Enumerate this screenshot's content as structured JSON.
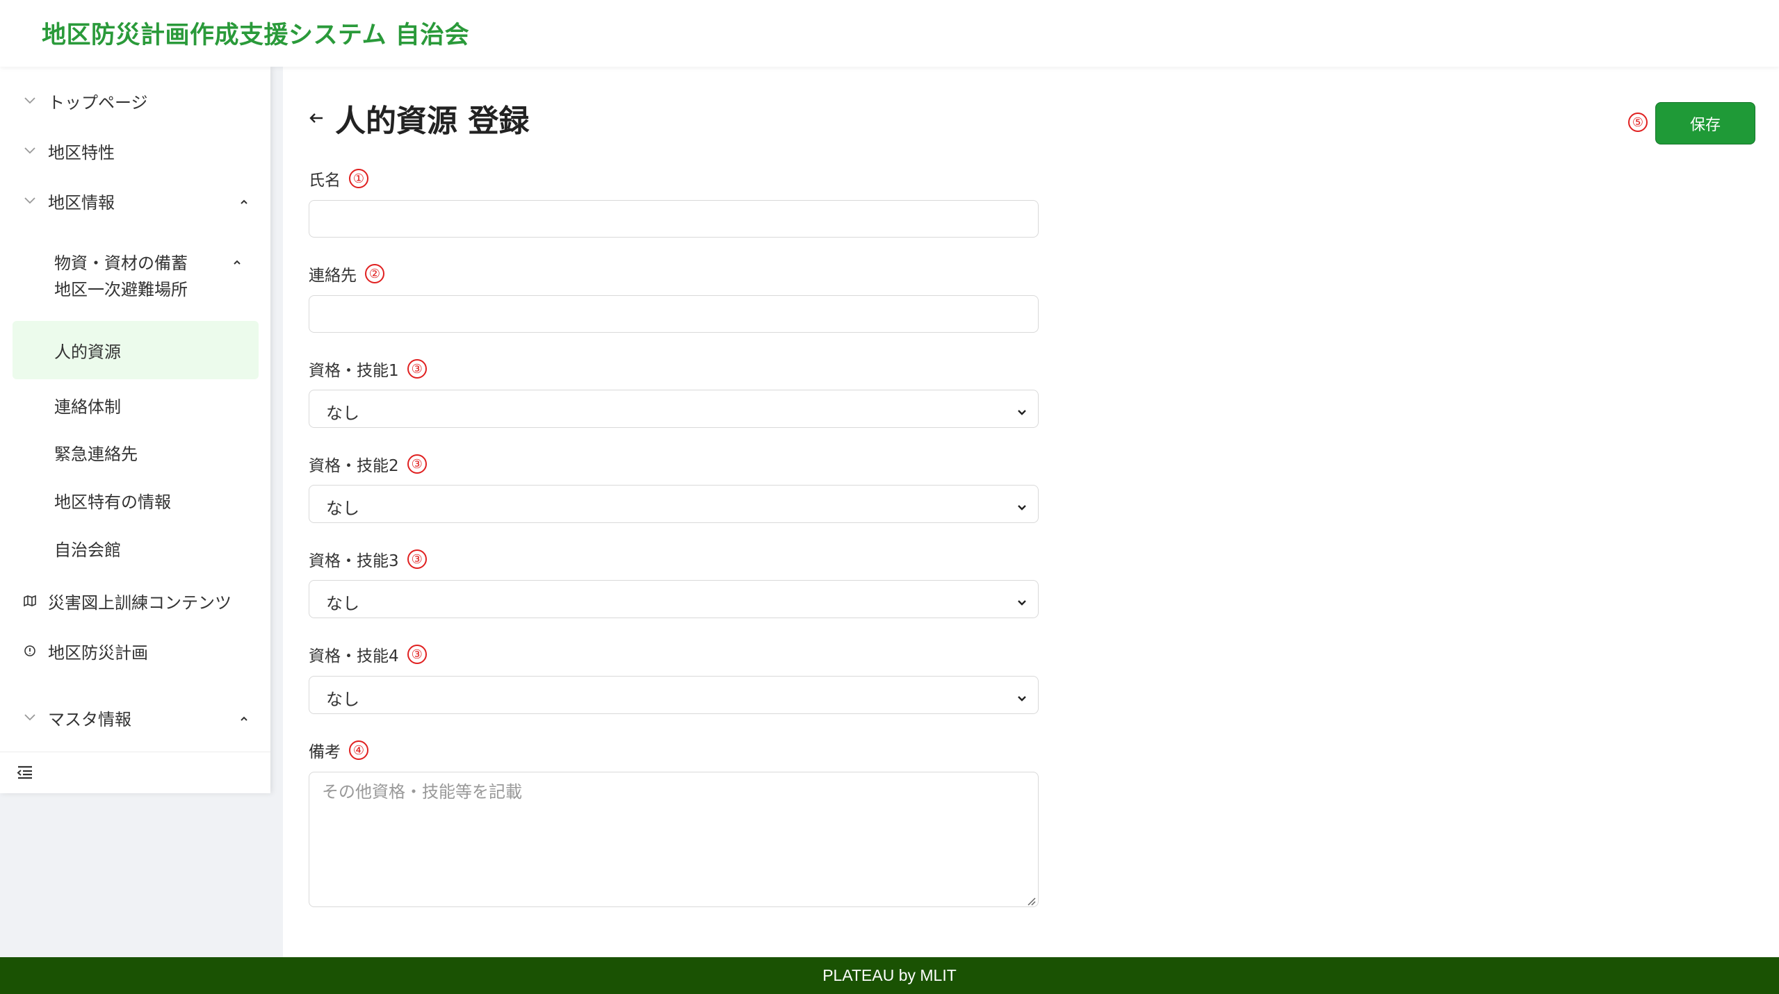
{
  "header": {
    "title": "地区防災計画作成支援システム 自治会"
  },
  "sidebar": {
    "top_items": [
      {
        "label": "トップページ"
      },
      {
        "label": "地区特性"
      },
      {
        "label": "地区情報"
      }
    ],
    "submenu_group": {
      "label": "物資・資材の備蓄"
    },
    "sub_items": [
      {
        "label": "地区一次避難場所"
      },
      {
        "label": "人的資源"
      },
      {
        "label": "連絡体制"
      },
      {
        "label": "緊急連絡先"
      },
      {
        "label": "地区特有の情報"
      },
      {
        "label": "自治会館"
      }
    ],
    "bottom_items": [
      {
        "label": "災害図上訓練コンテンツ"
      },
      {
        "label": "地区防災計画"
      },
      {
        "label": "マスタ情報"
      }
    ]
  },
  "page": {
    "title": "人的資源 登録"
  },
  "toolbar": {
    "save_label": "保存",
    "save_marker": "⑤"
  },
  "form": {
    "name": {
      "label": "氏名",
      "marker": "①",
      "value": ""
    },
    "contact": {
      "label": "連絡先",
      "marker": "②",
      "value": ""
    },
    "skills": [
      {
        "label": "資格・技能1",
        "marker": "③",
        "selected": "なし"
      },
      {
        "label": "資格・技能2",
        "marker": "③",
        "selected": "なし"
      },
      {
        "label": "資格・技能3",
        "marker": "③",
        "selected": "なし"
      },
      {
        "label": "資格・技能4",
        "marker": "③",
        "selected": "なし"
      }
    ],
    "notes": {
      "label": "備考",
      "marker": "④",
      "placeholder": "その他資格・技能等を記載"
    }
  },
  "footer": {
    "text": "PLATEAU by MLIT"
  },
  "colors": {
    "brand": "#2a9a3a",
    "save": "#1f9a37",
    "footer": "#1a5203",
    "marker": "#e02020",
    "active_bg": "#ecfbec"
  },
  "icons": [
    "chevron-down-icon",
    "chevron-up-icon",
    "map-icon",
    "info-circle-icon",
    "menu-collapse-icon",
    "arrow-left-icon"
  ]
}
